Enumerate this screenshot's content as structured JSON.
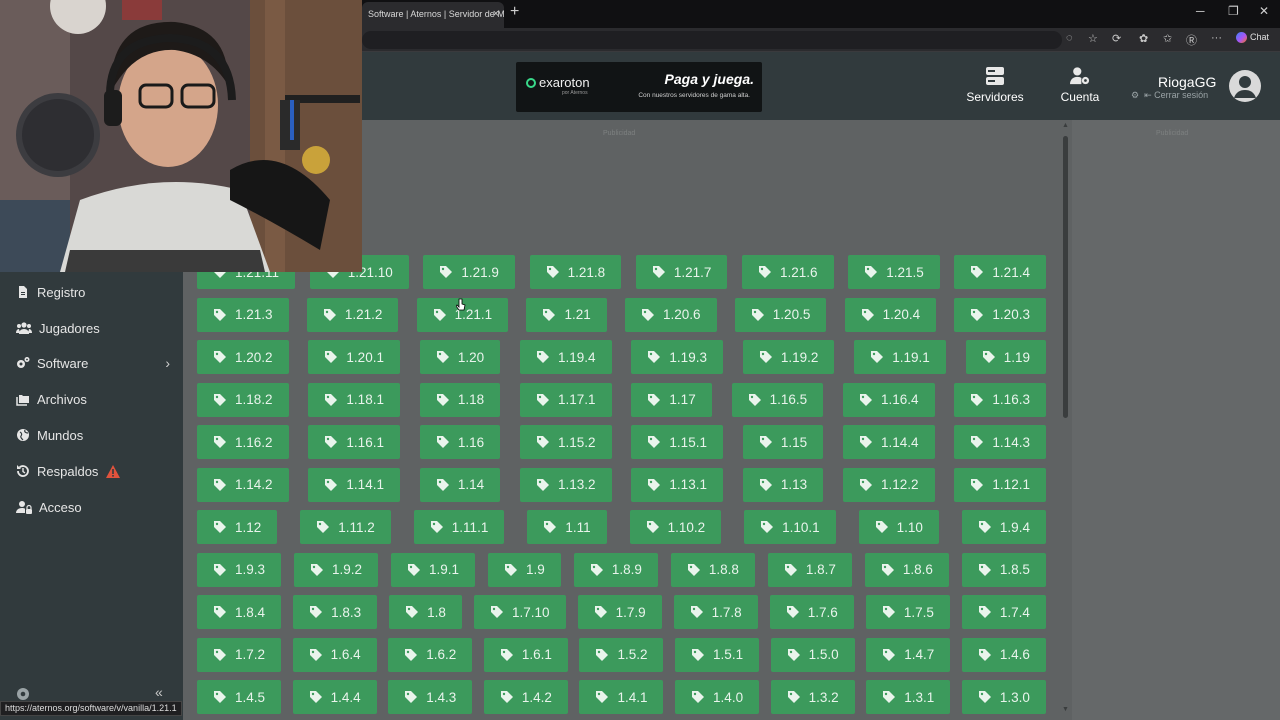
{
  "browser": {
    "tab_title": "Software | Aternos | Servidor de M",
    "tab_close": "×",
    "new_tab": "+",
    "chat_label": "Chat",
    "window_min": "─",
    "window_restore": "❐",
    "window_close": "✕"
  },
  "header": {
    "ad": {
      "brand": "exaroton",
      "brand_sub": "por Aternos",
      "headline": "Paga y juega.",
      "tagline": "Con nuestros servidores de gama alta."
    },
    "nav": {
      "servers": "Servidores",
      "account": "Cuenta"
    },
    "user": {
      "name": "RiogaGG",
      "logout": "Cerrar sesión"
    }
  },
  "content": {
    "ad_label": "Publicidad",
    "versions": [
      [
        "1.21.11",
        "1.21.10",
        "1.21.9",
        "1.21.8",
        "1.21.7",
        "1.21.6",
        "1.21.5",
        "1.21.4"
      ],
      [
        "1.21.3",
        "1.21.2",
        "1.21.1",
        "1.21",
        "1.20.6",
        "1.20.5",
        "1.20.4",
        "1.20.3"
      ],
      [
        "1.20.2",
        "1.20.1",
        "1.20",
        "1.19.4",
        "1.19.3",
        "1.19.2",
        "1.19.1",
        "1.19"
      ],
      [
        "1.18.2",
        "1.18.1",
        "1.18",
        "1.17.1",
        "1.17",
        "1.16.5",
        "1.16.4",
        "1.16.3"
      ],
      [
        "1.16.2",
        "1.16.1",
        "1.16",
        "1.15.2",
        "1.15.1",
        "1.15",
        "1.14.4",
        "1.14.3"
      ],
      [
        "1.14.2",
        "1.14.1",
        "1.14",
        "1.13.2",
        "1.13.1",
        "1.13",
        "1.12.2",
        "1.12.1"
      ],
      [
        "1.12",
        "1.11.2",
        "1.11.1",
        "1.11",
        "1.10.2",
        "1.10.1",
        "1.10",
        "1.9.4"
      ],
      [
        "1.9.3",
        "1.9.2",
        "1.9.1",
        "1.9",
        "1.8.9",
        "1.8.8",
        "1.8.7",
        "1.8.6",
        "1.8.5"
      ],
      [
        "1.8.4",
        "1.8.3",
        "1.8",
        "1.7.10",
        "1.7.9",
        "1.7.8",
        "1.7.6",
        "1.7.5",
        "1.7.4"
      ],
      [
        "1.7.2",
        "1.6.4",
        "1.6.2",
        "1.6.1",
        "1.5.2",
        "1.5.1",
        "1.5.0",
        "1.4.7",
        "1.4.6"
      ],
      [
        "1.4.5",
        "1.4.4",
        "1.4.3",
        "1.4.2",
        "1.4.1",
        "1.4.0",
        "1.3.2",
        "1.3.1",
        "1.3.0"
      ]
    ]
  },
  "sidebar": {
    "items": [
      {
        "label": "Registro",
        "icon": "file-icon"
      },
      {
        "label": "Jugadores",
        "icon": "users-icon"
      },
      {
        "label": "Software",
        "icon": "gears-icon"
      },
      {
        "label": "Archivos",
        "icon": "folders-icon"
      },
      {
        "label": "Mundos",
        "icon": "globe-icon"
      },
      {
        "label": "Respaldos",
        "icon": "history-icon"
      },
      {
        "label": "Acceso",
        "icon": "user-lock-icon"
      }
    ],
    "chevron": "›",
    "collapse": "«"
  },
  "status_url": "https://aternos.org/software/v/vanilla/1.21.1",
  "colors": {
    "version_button": "#3c9a5c",
    "header_bg": "#313a3d",
    "content_bg": "#5f6263",
    "warning": "#e0533d"
  }
}
